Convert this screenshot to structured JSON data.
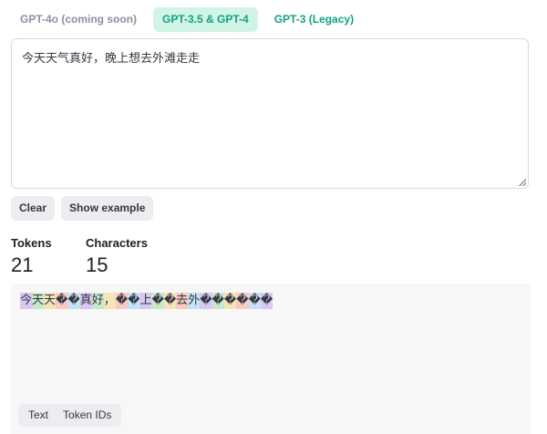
{
  "model_tabs": [
    {
      "label": "GPT-4o (coming soon)"
    },
    {
      "label": "GPT-3.5 & GPT-4"
    },
    {
      "label": "GPT-3 (Legacy)"
    }
  ],
  "input": {
    "value": "今天天气真好，晚上想去外滩走走"
  },
  "buttons": {
    "clear": "Clear",
    "show_example": "Show example"
  },
  "stats": {
    "tokens": {
      "label": "Tokens",
      "value": "21"
    },
    "characters": {
      "label": "Characters",
      "value": "15"
    }
  },
  "output_tokens": [
    {
      "text": "今",
      "color": "#d8c8f2"
    },
    {
      "text": "天",
      "color": "#c9e8c9"
    },
    {
      "text": "天",
      "color": "#f6e3b8"
    },
    {
      "text": "�",
      "color": "#f9c9c4"
    },
    {
      "text": "�",
      "color": "#c6e2f5"
    },
    {
      "text": "真",
      "color": "#d8c8f2"
    },
    {
      "text": "好",
      "color": "#c9e8c9"
    },
    {
      "text": "，",
      "color": "#f6e3b8"
    },
    {
      "text": "�",
      "color": "#f9c9c4"
    },
    {
      "text": "�",
      "color": "#c6e2f5"
    },
    {
      "text": "上",
      "color": "#d8c8f2"
    },
    {
      "text": "�",
      "color": "#c9e8c9"
    },
    {
      "text": "�",
      "color": "#f6e3b8"
    },
    {
      "text": "去",
      "color": "#f9c9c4"
    },
    {
      "text": "外",
      "color": "#c6e2f5"
    },
    {
      "text": "�",
      "color": "#d8c8f2"
    },
    {
      "text": "�",
      "color": "#c9e8c9"
    },
    {
      "text": "�",
      "color": "#f6e3b8"
    },
    {
      "text": "�",
      "color": "#f9c9c4"
    },
    {
      "text": "�",
      "color": "#c6e2f5"
    },
    {
      "text": "�",
      "color": "#d8c8f2"
    }
  ],
  "view_toggle": {
    "text": "Text",
    "token_ids": "Token IDs"
  }
}
